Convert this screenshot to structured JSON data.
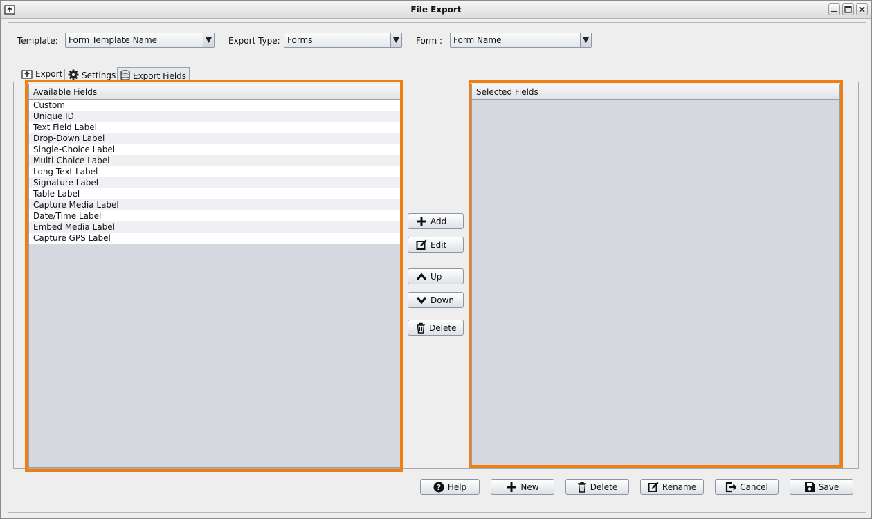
{
  "window": {
    "title": "File Export"
  },
  "toolbar": {
    "template_label": "Template:",
    "template_value": "Form Template Name",
    "export_type_label": "Export Type:",
    "export_type_value": "Forms",
    "form_label": "Form :",
    "form_value": "Form Name"
  },
  "tabs": [
    {
      "label": "Export",
      "icon": "export-icon"
    },
    {
      "label": "Settings",
      "icon": "gear-icon"
    },
    {
      "label": "Export Fields",
      "icon": "database-icon",
      "active": true
    }
  ],
  "available": {
    "header": "Available Fields",
    "items": [
      "Custom",
      "Unique ID",
      "Text Field Label",
      "Drop-Down Label",
      "Single-Choice Label",
      "Multi-Choice Label",
      "Long Text Label",
      "Signature Label",
      "Table Label",
      "Capture Media Label",
      "Date/Time Label",
      "Embed Media Label",
      "Capture GPS Label"
    ]
  },
  "selected": {
    "header": "Selected Fields",
    "items": []
  },
  "actions": {
    "add": "Add",
    "edit": "Edit",
    "up": "Up",
    "down": "Down",
    "delete": "Delete"
  },
  "footer": {
    "help": "Help",
    "new": "New",
    "delete": "Delete",
    "rename": "Rename",
    "cancel": "Cancel",
    "save": "Save"
  },
  "colors": {
    "highlight": "#f07f13",
    "list_bg": "#d5d8df"
  }
}
